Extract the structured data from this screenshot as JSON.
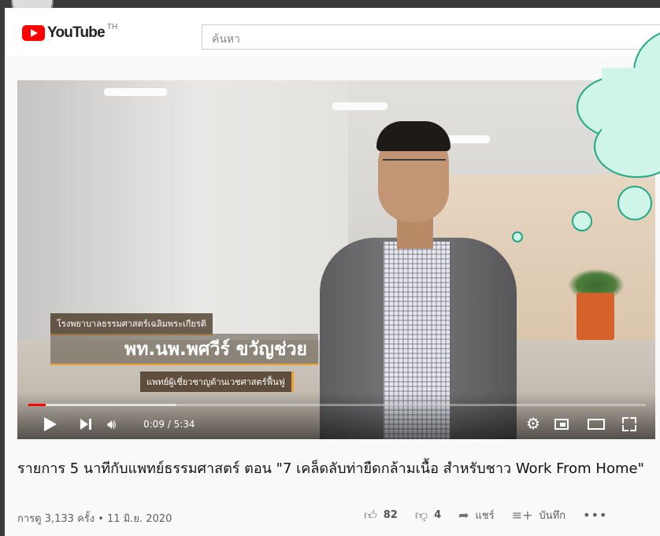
{
  "header": {
    "logo_text": "YouTube",
    "logo_region": "TH",
    "search_placeholder": "ค้นหา"
  },
  "video": {
    "caption_org": "โรงพยาบาลธรรมศาสตร์เฉลิมพระเกียรติ",
    "caption_name": "พท.นพ.พศวีร์ ขวัญช่วย",
    "caption_role": "แพทย์ผู้เชี่ยวชาญด้านเวชศาสตร์ฟื้นฟู",
    "time_display": "0:09 / 5:34",
    "played_fraction": 0.028,
    "buffered_fraction": 0.24
  },
  "title": "รายการ 5 นาทีกับแพทย์ธรรมศาสตร์ ตอน \"7 เคล็ดลับท่ายืดกล้ามเนื้อ สำหรับชาว Work From Home\"",
  "meta": "การดู 3,133 ครั้ง • 11 มิ.ย. 2020",
  "actions": {
    "likes": "82",
    "dislikes": "4",
    "share_label": "แชร์",
    "save_label": "บันทึก"
  },
  "colors": {
    "youtube_red": "#ff0000",
    "caption_accent": "#f0a030",
    "bubble_fill": "#cff4e8",
    "bubble_stroke": "#22a884"
  }
}
